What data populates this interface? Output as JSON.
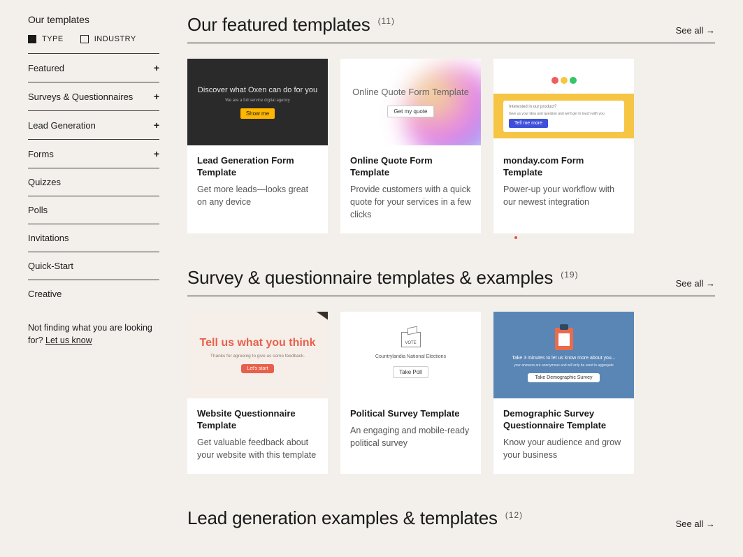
{
  "sidebar": {
    "title": "Our templates",
    "filters": {
      "type_label": "TYPE",
      "industry_label": "INDUSTRY"
    },
    "categories": [
      {
        "label": "Featured",
        "expandable": true
      },
      {
        "label": "Surveys & Questionnaires",
        "expandable": true
      },
      {
        "label": "Lead Generation",
        "expandable": true
      },
      {
        "label": "Forms",
        "expandable": true
      },
      {
        "label": "Quizzes",
        "expandable": false
      },
      {
        "label": "Polls",
        "expandable": false
      },
      {
        "label": "Invitations",
        "expandable": false
      },
      {
        "label": "Quick-Start",
        "expandable": false
      },
      {
        "label": "Creative",
        "expandable": false
      }
    ],
    "help_text": "Not finding what you are looking for?",
    "help_link": "Let us know"
  },
  "sections": {
    "featured": {
      "title": "Our featured templates",
      "count": "(11)",
      "see_all": "See all →",
      "cards": [
        {
          "media": {
            "headline": "Discover what Oxen can do for you",
            "sub": "We are a full service digital agency",
            "cta": "Show me"
          },
          "title": "Lead Generation Form Template",
          "desc": "Get more leads—looks great on any device"
        },
        {
          "media": {
            "headline": "Online Quote Form Template",
            "cta": "Get my quote"
          },
          "title": "Online Quote Form Template",
          "desc": "Provide customers with a quick quote for your services in a few clicks"
        },
        {
          "media": {
            "strip_q": "Interested in our product?",
            "strip_sub": "Give us your idea and question and we'll get in touch with you",
            "cta": "Tell me more"
          },
          "title": "monday.com Form Template",
          "desc": "Power-up your workflow with our newest integration"
        }
      ]
    },
    "surveys": {
      "title": "Survey & questionnaire templates & examples",
      "count": "(19)",
      "see_all": "See all →",
      "cards": [
        {
          "media": {
            "headline": "Tell us what you think",
            "sub": "Thanks for agreeing to give us some feedback.",
            "cta": "Let's start"
          },
          "title": "Website Questionnaire Template",
          "desc": "Get valuable feedback about your website with this template"
        },
        {
          "media": {
            "headline": "Countrylandia National Elections",
            "cta": "Take Poll",
            "icon_text": "VOTE"
          },
          "title": "Political Survey Template",
          "desc": "An engaging and mobile-ready political survey"
        },
        {
          "media": {
            "headline": "Take 3 minutes to let us know more about you...",
            "sub": "your answers are anonymous and will only be used in aggregate",
            "cta": "Take Demographic Survey"
          },
          "title": "Demographic Survey Questionnaire Template",
          "desc": "Know your audience and grow your business"
        }
      ]
    },
    "leadgen": {
      "title": "Lead generation examples & templates",
      "count": "(12)",
      "see_all": "See all →"
    }
  }
}
